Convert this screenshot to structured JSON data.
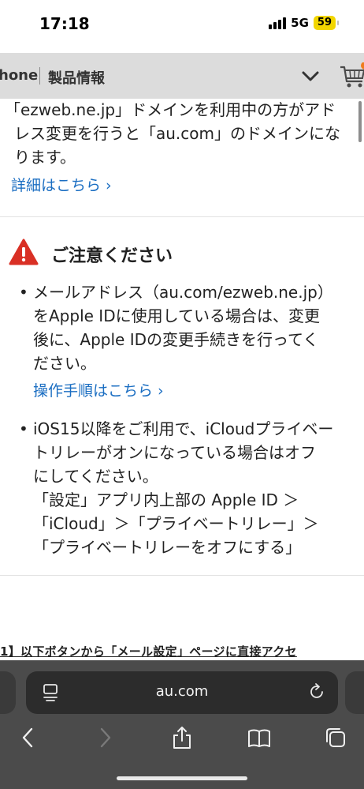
{
  "status_bar": {
    "time": "17:18",
    "network": "5G",
    "battery": "59"
  },
  "site_header": {
    "brand": "hone",
    "section": "製品情報"
  },
  "content": {
    "para1_line1": "「ezweb.ne.jp」ドメインを利用中の方がアド",
    "para1_line2": "レス変更を行うと「au.com」のドメインにな",
    "para1_line3": "ります。",
    "link1": "詳細はこちら ›",
    "warning_title": "ご注意ください",
    "bullet1_lines": [
      "メールアドレス（au.com/ezweb.ne.jp）",
      "をApple IDに使用している場合は、変更",
      "後に、Apple IDの変更手続きを行ってく",
      "ださい。"
    ],
    "link2": "操作手順はこちら ›",
    "bullet2_lines": [
      "iOS15以降をご利用で、iCloudプライベー",
      "トリレーがオンになっている場合はオフ",
      "にしてください。",
      "「設定」アプリ内上部の Apple ID ＞",
      "「iCloud」＞「プライベートリレー」＞",
      "「プライベートリレーをオフにする」"
    ],
    "step_heading": "1】以下ボタンから「メール設定」ページに直接アクセ"
  },
  "browser": {
    "url": "au.com"
  },
  "colors": {
    "link": "#1b6ec2",
    "warning": "#d93025",
    "battery": "#f2d600",
    "header_bg": "#dcdcdc",
    "toolbar_bg": "#4b4b4b",
    "cart_badge": "#f07b1e"
  },
  "icons": {
    "header": [
      "chevron-down-icon",
      "cart-icon"
    ],
    "warning": "warning-icon",
    "toolbar": [
      "back-icon",
      "forward-icon",
      "share-icon",
      "bookmarks-icon",
      "tabs-icon"
    ],
    "urlbar": [
      "page-format-icon",
      "reload-icon"
    ]
  }
}
